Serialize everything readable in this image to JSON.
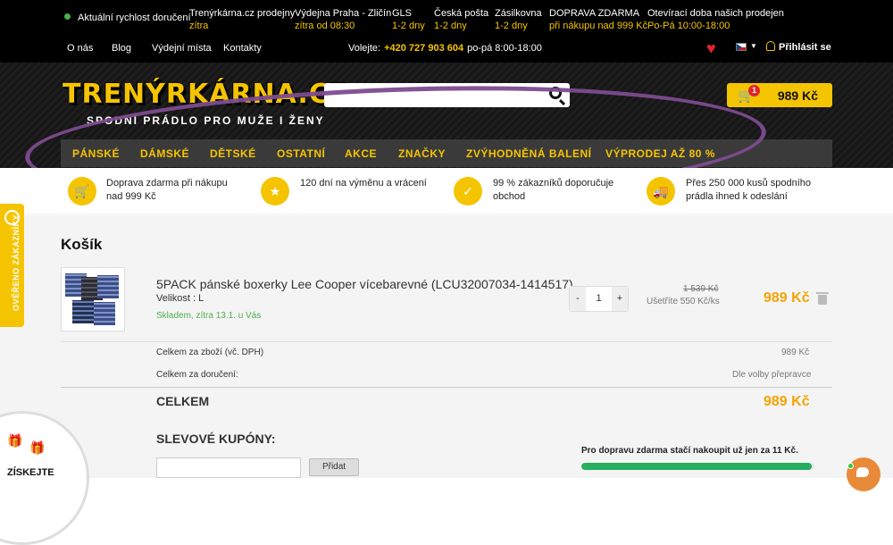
{
  "topbar": {
    "delivery_label": "Aktuální rychlost doručení",
    "delivery_columns": [
      {
        "title": "Trenýrkárna.cz prodejny",
        "sub": "zítra"
      },
      {
        "title": "Výdejna Praha - Zličín",
        "sub": "zítra od 08:30"
      },
      {
        "title": "GLS",
        "sub": "1-2 dny"
      },
      {
        "title": "Česká pošta",
        "sub": "1-2 dny"
      },
      {
        "title": "Zásilkovna",
        "sub": "1-2 dny"
      },
      {
        "title": "DOPRAVA ZDARMA",
        "sub": "při nákupu nad 999 Kč"
      },
      {
        "title": "Otevírací doba našich prodejen",
        "sub": "Po-Pá 10:00-18:00"
      }
    ],
    "links": [
      "O nás",
      "Blog",
      "Výdejní místa",
      "Kontakty"
    ],
    "phone_label": "Volejte:",
    "phone": "+420 727 903 604",
    "phone_hours": "po-pá 8:00-18:00",
    "login": "Přihlásit se"
  },
  "header": {
    "logo": "TRENÝRKÁRNA.CZ",
    "tagline": "SPODNÍ PRÁDLO PRO MUŽE I ŽENY",
    "cart_count": "1",
    "cart_total": "989 Kč"
  },
  "menu": [
    "PÁNSKÉ",
    "DÁMSKÉ",
    "DĚTSKÉ",
    "OSTATNÍ",
    "AKCE",
    "ZNAČKY",
    "ZVÝHODNĚNÁ BALENÍ",
    "VÝPRODEJ AŽ 80 %"
  ],
  "benefits": [
    {
      "line1": "Doprava zdarma při nákupu",
      "line2": "nad 999 Kč"
    },
    {
      "line1": "120 dní na výměnu a vrácení",
      "line2": ""
    },
    {
      "line1": "99 % zákazníků doporučuje",
      "line2": "obchod"
    },
    {
      "line1": "Přes 250 000 kusů spodního",
      "line2": "prádla ihned k odeslání"
    }
  ],
  "side_badge": "OVĚŘENO ZÁKAZNÍKY",
  "cart": {
    "title": "Košík",
    "item": {
      "name": "5PACK pánské boxerky Lee Cooper vícebarevné (LCU32007034-1414517)",
      "size": "Velikost : L",
      "stock": "Skladem, zítra 13.1. u Vás",
      "qty_minus": "-",
      "qty": "1",
      "qty_plus": "+",
      "old_price": "1 539 Kč",
      "saving": "Ušetříte 550 Kč/ks",
      "price": "989 Kč"
    },
    "subtotal_label": "Celkem za zboží (vč. DPH)",
    "subtotal_value": "989 Kč",
    "shipping_label": "Celkem za doručení:",
    "shipping_value": "Dle volby přepravce",
    "total_label": "CELKEM",
    "total_value": "989 Kč",
    "coupon_title": "SLEVOVÉ KUPÓNY:",
    "coupon_button": "Přidat",
    "free_shipping_msg": "Pro dopravu zdarma stačí nakoupit už jen za 11 Kč.",
    "free_shipping_progress": 0.99
  },
  "wheel_label": "ZÍSKEJTE"
}
